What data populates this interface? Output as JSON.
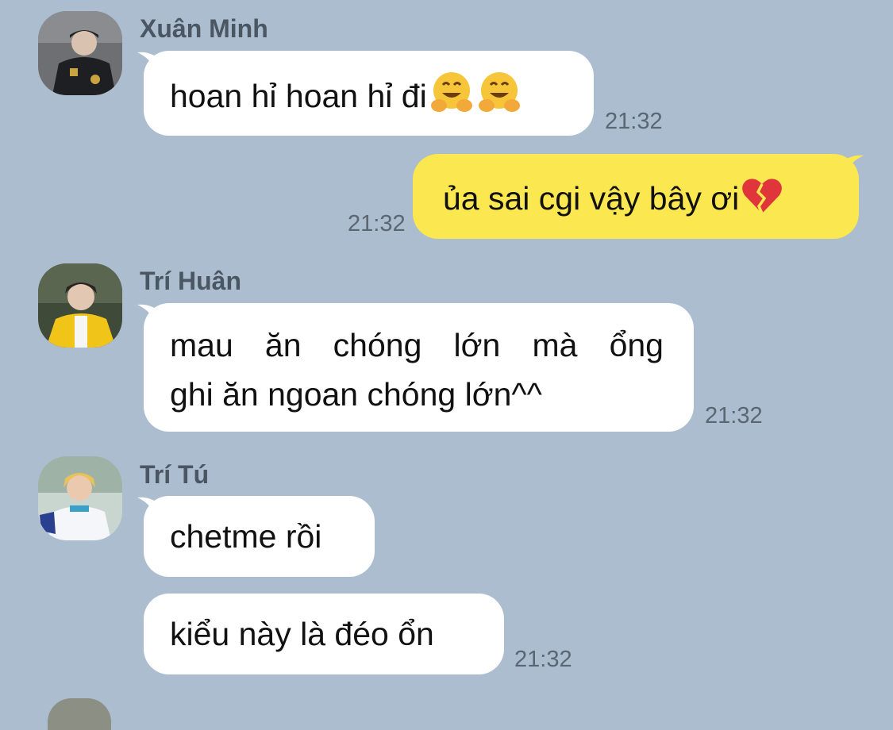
{
  "messages": [
    {
      "sender": "Xuân Minh",
      "lines": [
        "hoan hỉ hoan hỉ đi"
      ],
      "emoji": [
        "hugging-face",
        "hugging-face"
      ],
      "time": "21:32"
    },
    {
      "sender": "",
      "lines": [
        "ủa sai cgi vậy bây ơi"
      ],
      "emoji": [
        "broken-heart"
      ],
      "time": "21:32",
      "outgoing": true
    },
    {
      "sender": "Trí Huân",
      "lines": [
        "mau ăn chóng lớn mà ổng",
        "ghi ăn ngoan chóng lớn^^"
      ],
      "time": "21:32"
    },
    {
      "sender": "Trí Tú",
      "lines": [
        "chetme rồi"
      ],
      "time": ""
    },
    {
      "sender": "",
      "lines": [
        "kiểu này là đéo ổn"
      ],
      "time": "21:32"
    }
  ],
  "words": {
    "m2l0": [
      "mau",
      "ăn",
      "chóng",
      "lớn",
      "mà",
      "ổng"
    ]
  },
  "colors": {
    "background": "#abbdcf",
    "incoming_bubble": "#ffffff",
    "outgoing_bubble": "#fbe74f",
    "sender_name": "#4b5663",
    "timestamp": "#5b6673"
  }
}
